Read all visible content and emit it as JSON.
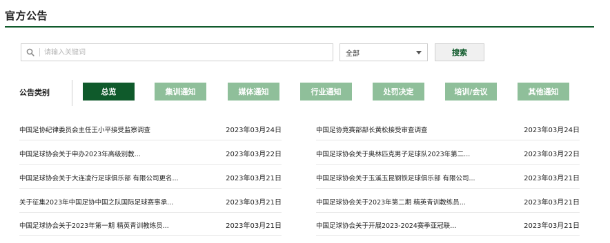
{
  "header": {
    "title": "官方公告"
  },
  "search": {
    "placeholder": "请输入关键词",
    "select_value": "全部",
    "button_label": "搜索"
  },
  "category": {
    "label": "公告类别",
    "items": [
      {
        "label": "总览",
        "active": true
      },
      {
        "label": "集训通知",
        "active": false
      },
      {
        "label": "媒体通知",
        "active": false
      },
      {
        "label": "行业通知",
        "active": false
      },
      {
        "label": "处罚决定",
        "active": false
      },
      {
        "label": "培训/会议",
        "active": false
      },
      {
        "label": "其他通知",
        "active": false
      }
    ]
  },
  "news": {
    "left": [
      {
        "title": "中国足协纪律委员会主任王小平接受监察调查",
        "date": "2023年03月24日"
      },
      {
        "title": "中国足球协会关于申办2023年高级别教...",
        "date": "2023年03月22日"
      },
      {
        "title": "中国足球协会关于大连凌行足球俱乐部 有限公司更名...",
        "date": "2023年03月21日"
      },
      {
        "title": "关于征集2023年中国足协中国之队国际足球赛事承...",
        "date": "2023年03月21日"
      },
      {
        "title": "中国足球协会关于2023年第一期 精英青训教练员...",
        "date": "2023年03月21日"
      }
    ],
    "right": [
      {
        "title": "中国足协竞赛部部长黄松接受审查调查",
        "date": "2023年03月24日"
      },
      {
        "title": "中国足球协会关于奥林匹克男子足球队2023年第二...",
        "date": "2023年03月22日"
      },
      {
        "title": "中国足球协会关于玉溪玉昆钢铁足球俱乐部 有限公司...",
        "date": "2023年03月21日"
      },
      {
        "title": "中国足球协会关于2023年第二期 精英青训教练员...",
        "date": "2023年03月21日"
      },
      {
        "title": "中国足球协会关于开展2023-2024赛季亚冠联...",
        "date": "2023年03月21日"
      }
    ]
  },
  "colors": {
    "brand_green": "#0f5a2b",
    "inactive_green": "#8fbf9a"
  },
  "icons": {
    "search": "search-icon",
    "dropdown": "chevron-down-icon"
  }
}
